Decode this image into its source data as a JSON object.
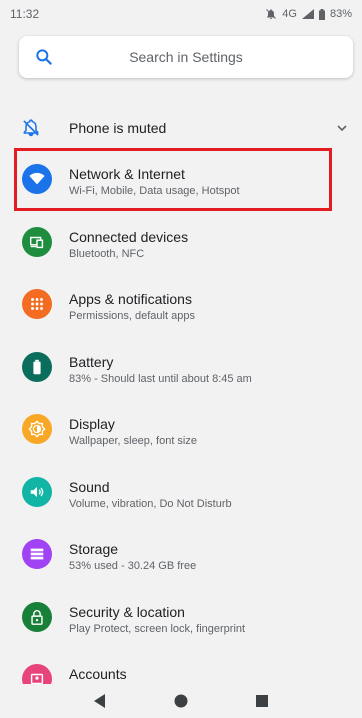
{
  "status": {
    "time": "11:32",
    "network": "4G",
    "battery": "83%"
  },
  "search": {
    "placeholder": "Search in Settings"
  },
  "suggestion": {
    "label": "Phone is muted"
  },
  "items": [
    {
      "title": "Network & Internet",
      "subtitle": "Wi-Fi, Mobile, Data usage, Hotspot",
      "icon": "wifi-icon",
      "color": "#1a73e8"
    },
    {
      "title": "Connected devices",
      "subtitle": "Bluetooth, NFC",
      "icon": "devices-icon",
      "color": "#1e8e3e"
    },
    {
      "title": "Apps & notifications",
      "subtitle": "Permissions, default apps",
      "icon": "apps-icon",
      "color": "#f36c21"
    },
    {
      "title": "Battery",
      "subtitle": "83% - Should last until about 8:45 am",
      "icon": "battery-icon",
      "color": "#0b6e5c"
    },
    {
      "title": "Display",
      "subtitle": "Wallpaper, sleep, font size",
      "icon": "display-icon",
      "color": "#f9a825"
    },
    {
      "title": "Sound",
      "subtitle": "Volume, vibration, Do Not Disturb",
      "icon": "sound-icon",
      "color": "#12b5a5"
    },
    {
      "title": "Storage",
      "subtitle": "53% used - 30.24 GB free",
      "icon": "storage-icon",
      "color": "#a142f4"
    },
    {
      "title": "Security & location",
      "subtitle": "Play Protect, screen lock, fingerprint",
      "icon": "lock-icon",
      "color": "#188038"
    },
    {
      "title": "Accounts",
      "subtitle": "",
      "icon": "accounts-icon",
      "color": "#e8437a"
    }
  ]
}
